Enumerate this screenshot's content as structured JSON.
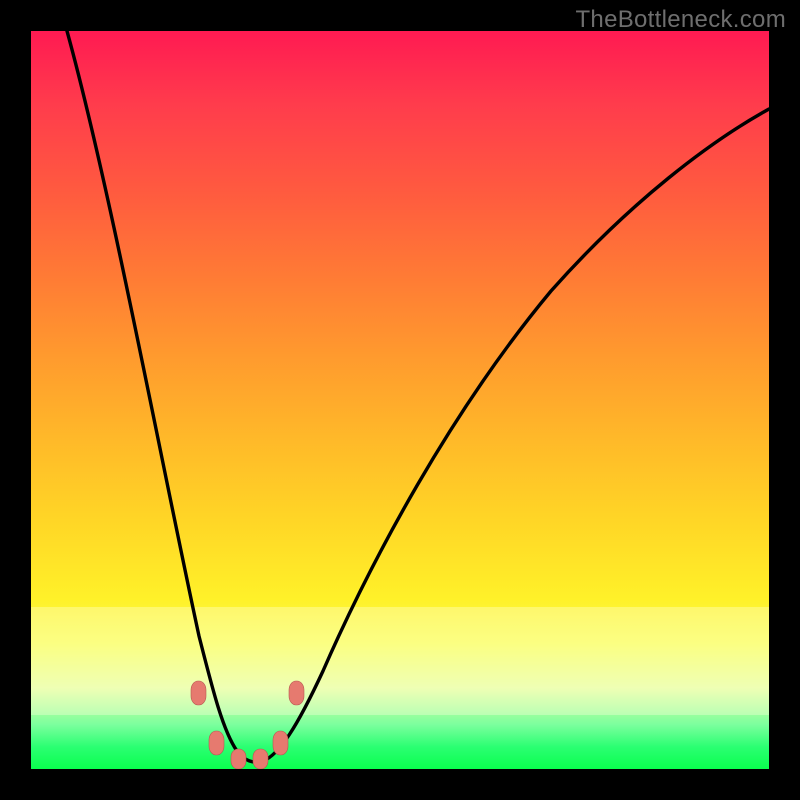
{
  "watermark": "TheBottleneck.com",
  "colors": {
    "frame": "#000000",
    "gradient_top": "#ff1a52",
    "gradient_bottom": "#0aff4e",
    "curve": "#000000",
    "bead": "#e67a6f"
  },
  "chart_data": {
    "type": "line",
    "title": "",
    "xlabel": "",
    "ylabel": "",
    "xlim": [
      0,
      100
    ],
    "ylim": [
      0,
      100
    ],
    "note": "No axes, ticks, or numeric labels are visible; values are estimated from pixel positions on a 0-100 normalized grid.",
    "series": [
      {
        "name": "bottleneck-curve",
        "x": [
          5,
          8,
          12,
          16,
          20,
          23,
          25,
          27,
          29,
          31,
          33,
          36,
          40,
          46,
          54,
          62,
          70,
          78,
          86,
          94,
          100
        ],
        "y": [
          100,
          85,
          70,
          55,
          40,
          26,
          16,
          8,
          3,
          1,
          3,
          8,
          18,
          32,
          48,
          60,
          70,
          78,
          84,
          88,
          91
        ]
      }
    ],
    "markers": [
      {
        "name": "bead-left-upper",
        "x": 22.5,
        "y": 10
      },
      {
        "name": "bead-left-lower",
        "x": 25.0,
        "y": 3
      },
      {
        "name": "bead-bottom-1",
        "x": 28.0,
        "y": 1
      },
      {
        "name": "bead-bottom-2",
        "x": 31.0,
        "y": 1
      },
      {
        "name": "bead-right-lower",
        "x": 33.5,
        "y": 3
      },
      {
        "name": "bead-right-upper",
        "x": 36.0,
        "y": 10
      }
    ],
    "light_band": {
      "y_from": 77,
      "y_to": 92
    }
  }
}
